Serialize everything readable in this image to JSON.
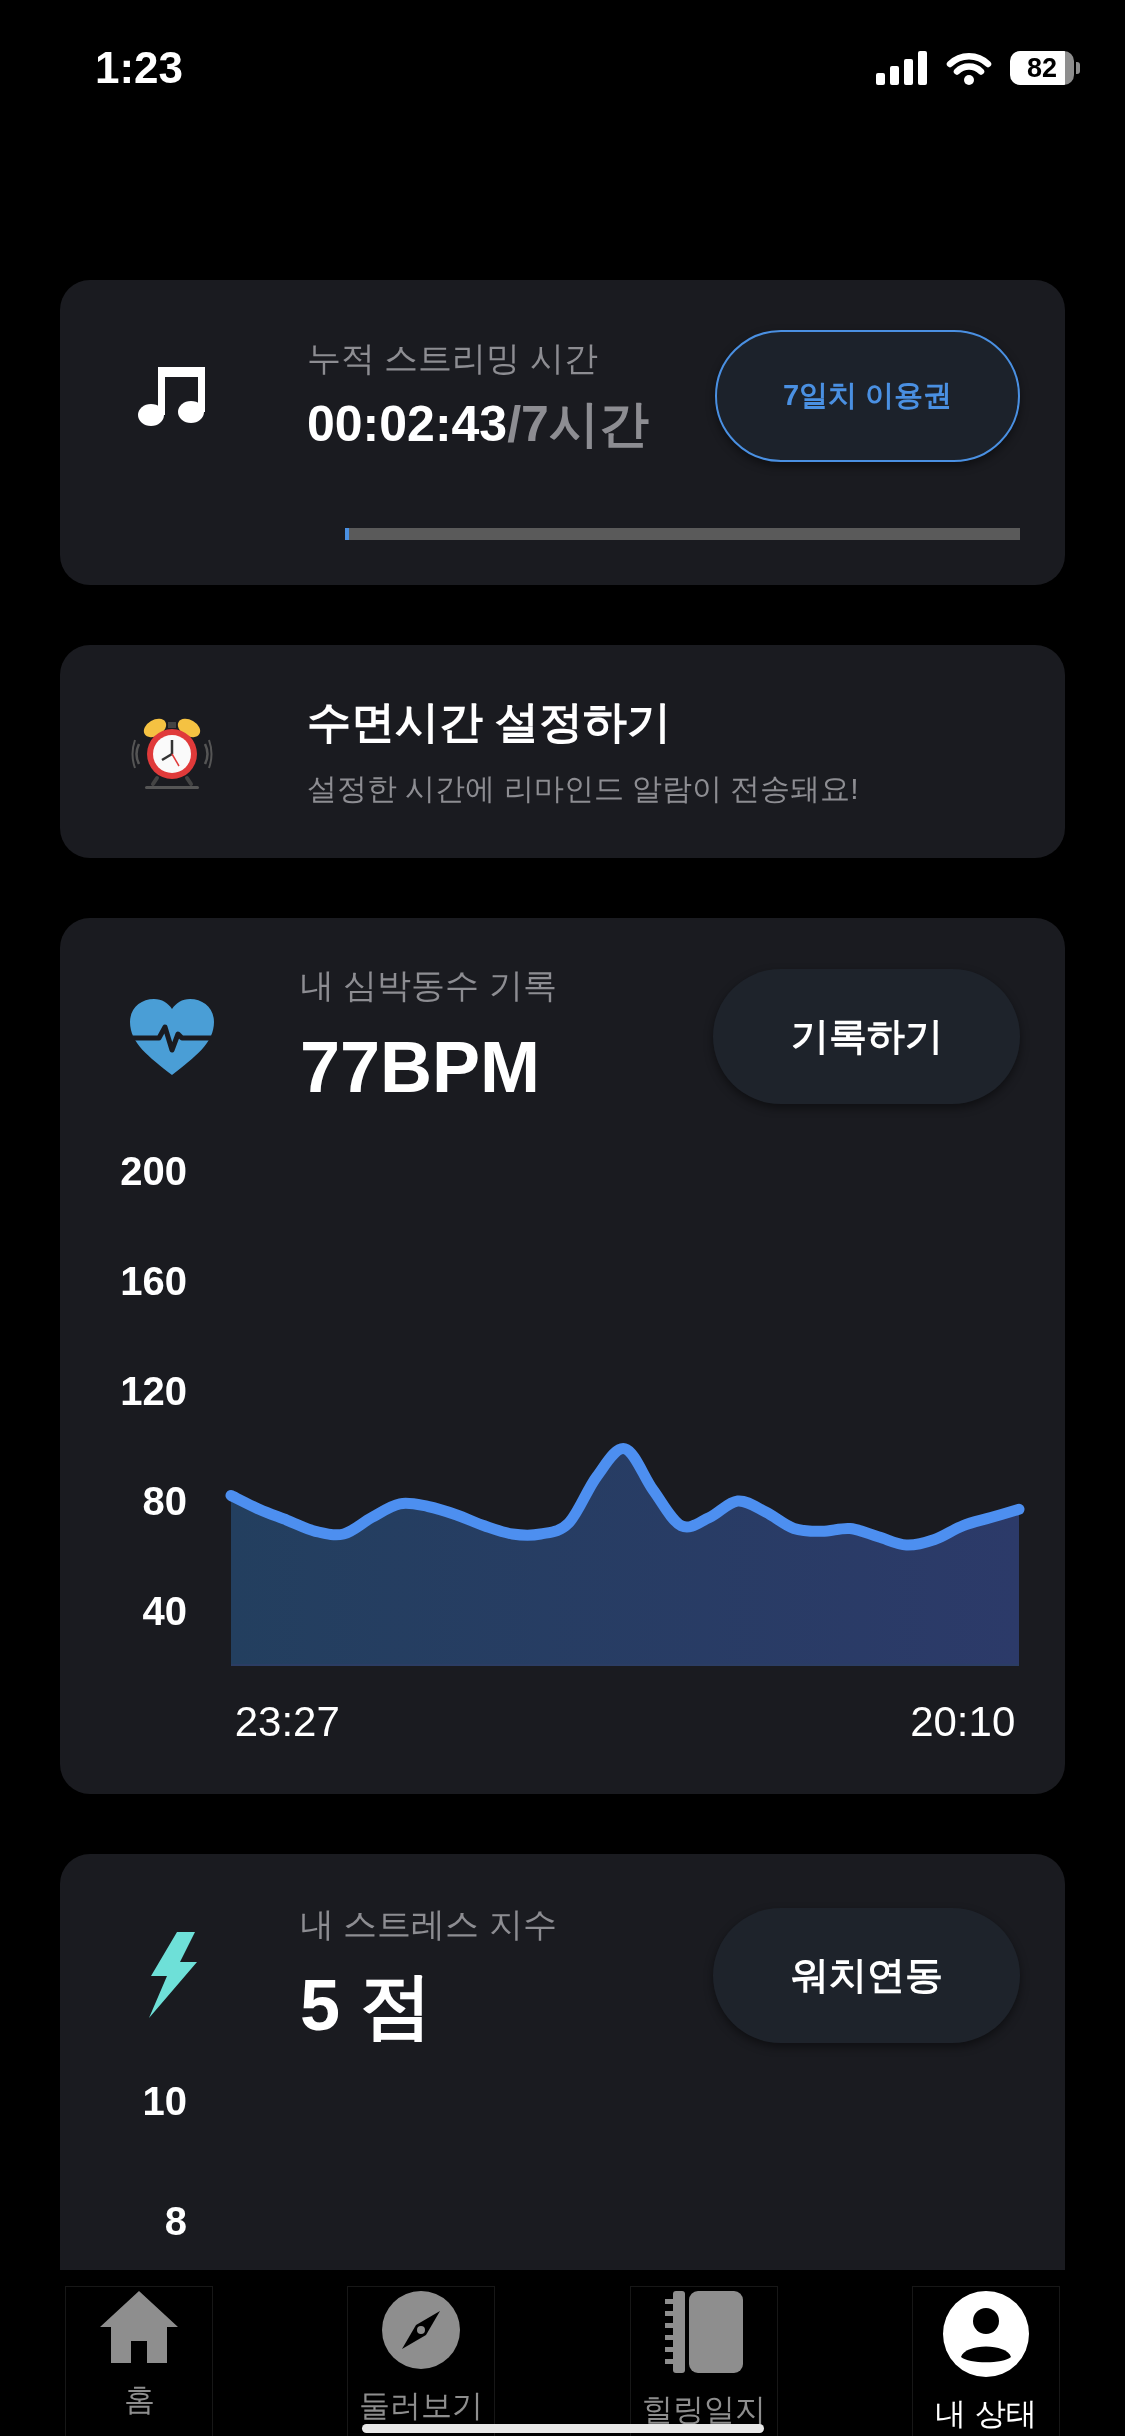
{
  "status_bar": {
    "time": "1:23",
    "battery": "82"
  },
  "streaming_card": {
    "label": "누적 스트리밍 시간",
    "elapsed": "00:02:43",
    "total": "/7시간",
    "button": "7일치 이용권",
    "progress": {
      "level": 0.006
    }
  },
  "sleep_card": {
    "title": "수면시간 설정하기",
    "subtitle": "설정한 시간에 리마인드 알람이 전송돼요!"
  },
  "heart_rate_card": {
    "label": "내 심박동수 기록",
    "value": "77BPM",
    "button": "기록하기",
    "chart_data": {
      "type": "area",
      "categories": [
        null,
        null,
        "23:27",
        null,
        null,
        null,
        null,
        null,
        null,
        null,
        null,
        null,
        null,
        null,
        null,
        null,
        null,
        null,
        null,
        null,
        null,
        null,
        null,
        null,
        null,
        null,
        "20:10",
        null,
        null
      ],
      "series": [
        {
          "color": "#4d8ff0",
          "values": [
            82,
            77,
            73,
            69,
            68,
            74,
            79,
            78,
            75,
            71,
            68,
            68,
            72,
            89,
            99,
            84,
            71,
            74,
            80,
            76,
            70,
            69,
            70,
            67,
            64,
            66,
            71,
            74,
            77
          ]
        }
      ],
      "ylim": [
        20,
        200
      ],
      "yticks": [
        40,
        80,
        120,
        160,
        200
      ]
    }
  },
  "stress_card": {
    "label": "내 스트레스 지수",
    "value": "5 점",
    "button": "워치연동",
    "y_axis_labels": [
      "10",
      "8"
    ]
  },
  "tab_bar": {
    "tabs": [
      {
        "label": "홈",
        "selected": false
      },
      {
        "label": "둘러보기",
        "selected": false
      },
      {
        "label": "힐링일지",
        "selected": false
      },
      {
        "label": "내 상태",
        "selected": true
      }
    ]
  }
}
